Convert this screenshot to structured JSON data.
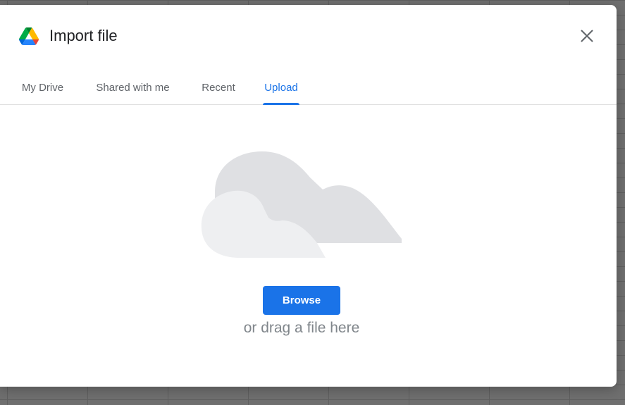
{
  "dialog": {
    "title": "Import file",
    "logo_icon": "google-drive-logo",
    "close_icon": "close-icon"
  },
  "tabs": [
    {
      "label": "My Drive",
      "active": false
    },
    {
      "label": "Shared with me",
      "active": false
    },
    {
      "label": "Recent",
      "active": false
    },
    {
      "label": "Upload",
      "active": true
    }
  ],
  "upload": {
    "illustration_icon": "cloud-illustration",
    "browse_label": "Browse",
    "drag_text": "or drag a file here"
  },
  "colors": {
    "accent": "#1a73e8",
    "tab_inactive": "#5f6368",
    "title": "#202124",
    "hint_text": "#80868b",
    "cloud_back": "#dfe0e3",
    "cloud_front": "#eeeff1"
  }
}
